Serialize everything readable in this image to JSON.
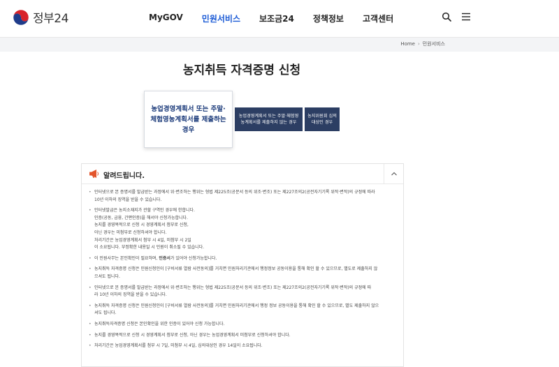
{
  "header": {
    "logo_text": "정부24",
    "nav": [
      "MyGOV",
      "민원서비스",
      "보조금24",
      "정책정보",
      "고객센터"
    ],
    "active_nav": "민원서비스",
    "icons": [
      "search-icon",
      "menu-icon"
    ]
  },
  "breadcrumb": {
    "home": "Home",
    "current": "민원서비스"
  },
  "title": "농지취득 자격증명 신청",
  "tabs": {
    "selected": "농업경영계획서 또는 주말·체험영농계획서를 제출하는 경우",
    "second": "농업경영계획서 또는 주말·체험영농계획서를 제출하지 않는 경우",
    "third": "농지위원회 심의대상인 경우"
  },
  "notice": {
    "title": "알려드립니다.",
    "items": [
      [
        "인터넷으로 본 증명서를 발급받는 과정에서 위·변조하는 행위는 형법 제225조(공문서 등의 위조·변조) 또는 제227조의2(공전자기기록 위작·변작)의 규정에 따라",
        "10년 이하의 징역을 받을 수 있습니다."
      ],
      [
        "인터넷발급은 농지소재지가 관할 구역인 경우에 한합니다.",
        "인증(공동, 금융, 간편인증)을 해서야 신청가능합니다.",
        "농지를 경영목적으로 신청 시 경영계획서 첨부로 신청,",
        "아닌 경우는 미첨부로 신청하셔야 합니다.",
        "처리기간은 농업경영계획서 첨부 시 4일, 미첨부 시 2일",
        "이 소요됩니다. 부정확한 내용일 시 민원이 취소될 수 있습니다."
      ],
      [
        "이 민원사무는 본인확인이 필요하며, 인증서가 있어야 신청가능합니다."
      ],
      [
        "농지취득 자격증명 신청은 민원신청인이 [구비서류 열람 사전동의]를 거치면 민원처리기관에서 행정정보 공동이용을 통해 확인 할 수 있으므로, 별도로 제출하지 않",
        "으셔도 됩니다."
      ],
      [
        "인터넷으로 본 증명서를 발급받는 과정에서 위·변조하는 행위는 형법 제225조(공문서 등의 위조·변조) 또는 제227조의2(공전자기기록 위작·변작)의 규정에 따",
        "라 10년 이하의 징역을 받을 수 있습니다."
      ],
      [
        "농지취득 자격증명 신청은 민원신청인이 [구비서류 열람 사전동의]를 거치면 민원처리기관에서 행정 정보 공동이용을 통해 확인 할 수 있으므로, 별도 제출하지 않으",
        "셔도 됩니다."
      ],
      [
        "농지취득자격증명 신청은 본인확인을 위한 인증이 있어야 신청 가능합니다."
      ],
      [
        "농지를 경영목적으로 신청 시 경영계획서 첨부로 신청, 아닌 경우는 농업경영계획서 미첨부로 신청하셔야 합니다."
      ],
      [
        "처리기간은 농업경영계획서를 첨부 시 7일, 미첨부 시 4일, 심의대상인 경우 14일이 소요됩니다."
      ]
    ],
    "highlight_word": "인증서"
  }
}
